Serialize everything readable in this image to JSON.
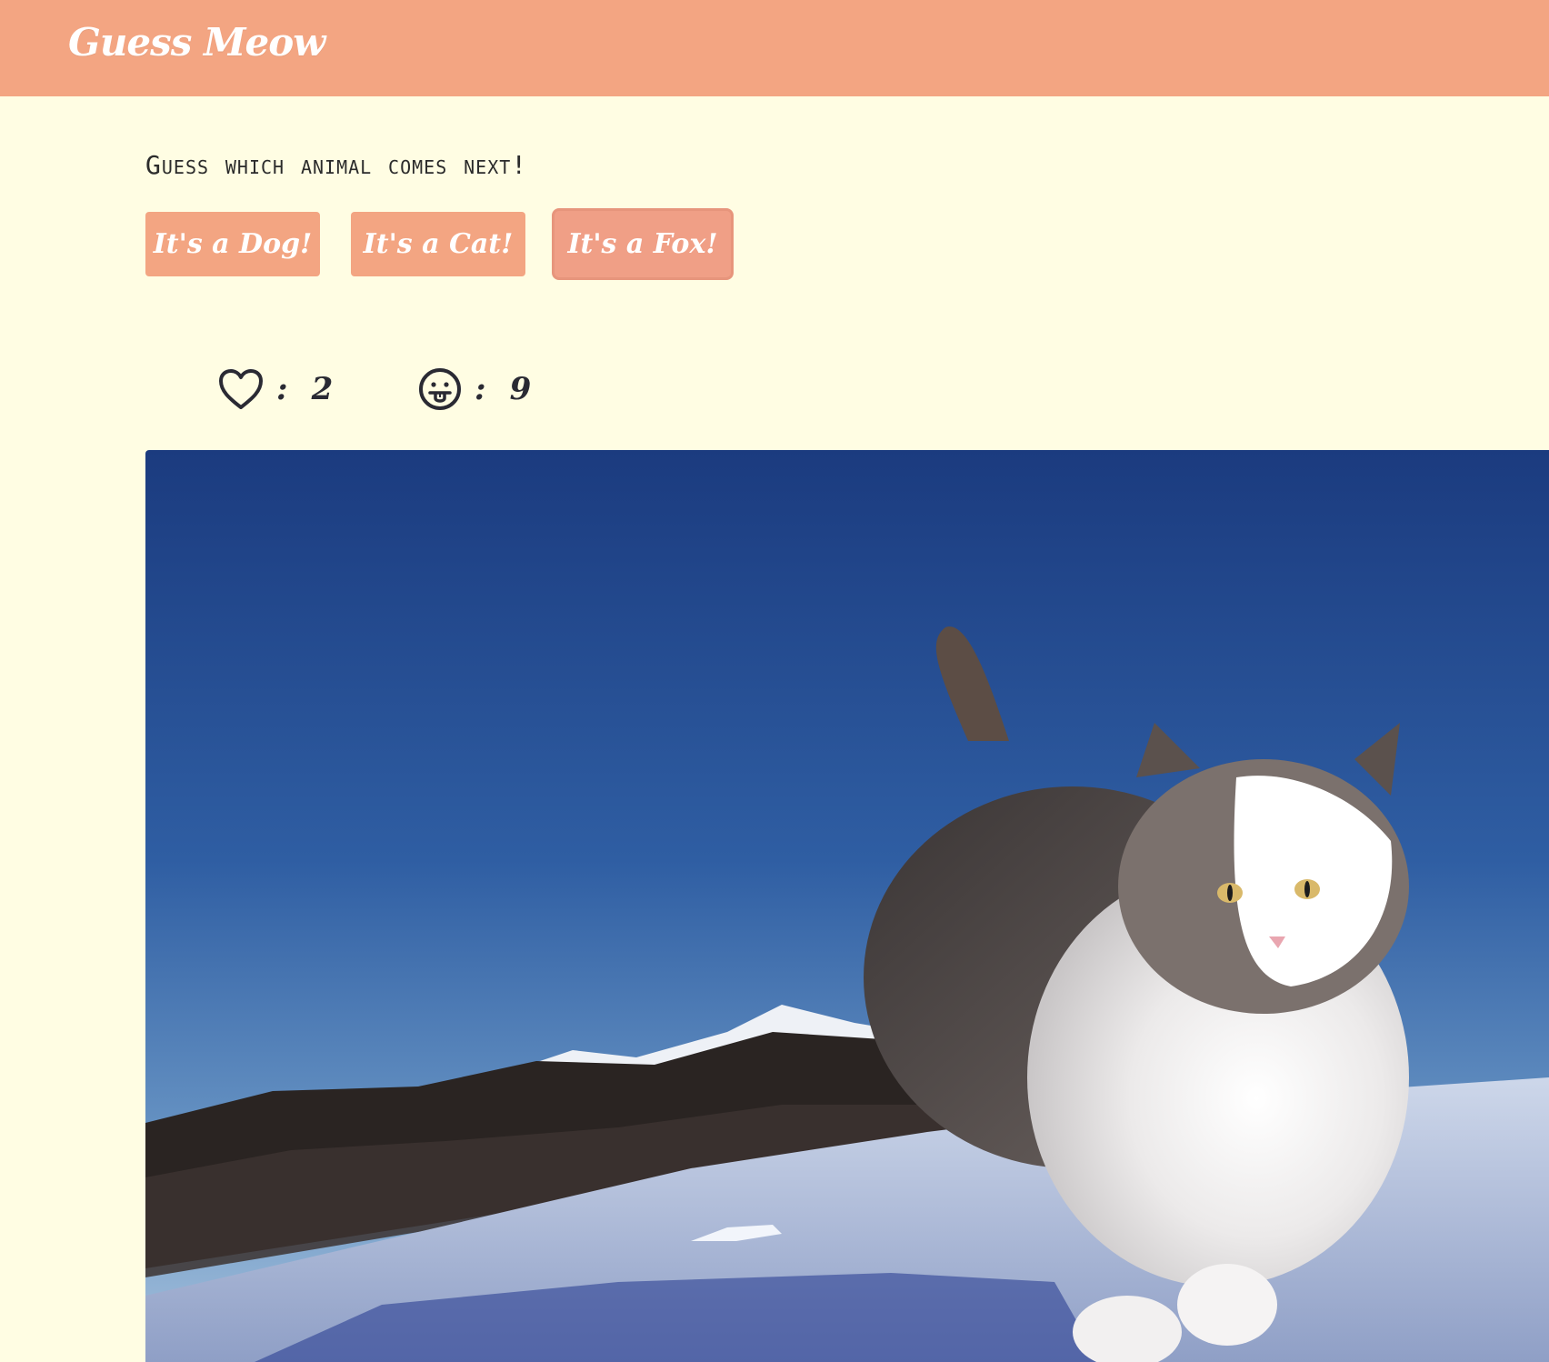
{
  "header": {
    "brand": "Guess Meow",
    "bg_color": "#f3a582"
  },
  "main": {
    "prompt": "Guess which animal comes next!",
    "buttons": [
      {
        "label": "It's a Dog!",
        "state": "default"
      },
      {
        "label": "It's a Cat!",
        "state": "default"
      },
      {
        "label": "It's a Fox!",
        "state": "hover"
      }
    ],
    "stats": {
      "likes": {
        "icon": "heart-outline-icon",
        "separator": ":",
        "value": "2"
      },
      "tongue": {
        "icon": "face-tongue-icon",
        "separator": ":",
        "value": "9"
      }
    },
    "image": {
      "subject": "cat"
    }
  },
  "colors": {
    "page_bg": "#fffde3",
    "accent": "#f3a582",
    "text": "#2a2a33"
  }
}
